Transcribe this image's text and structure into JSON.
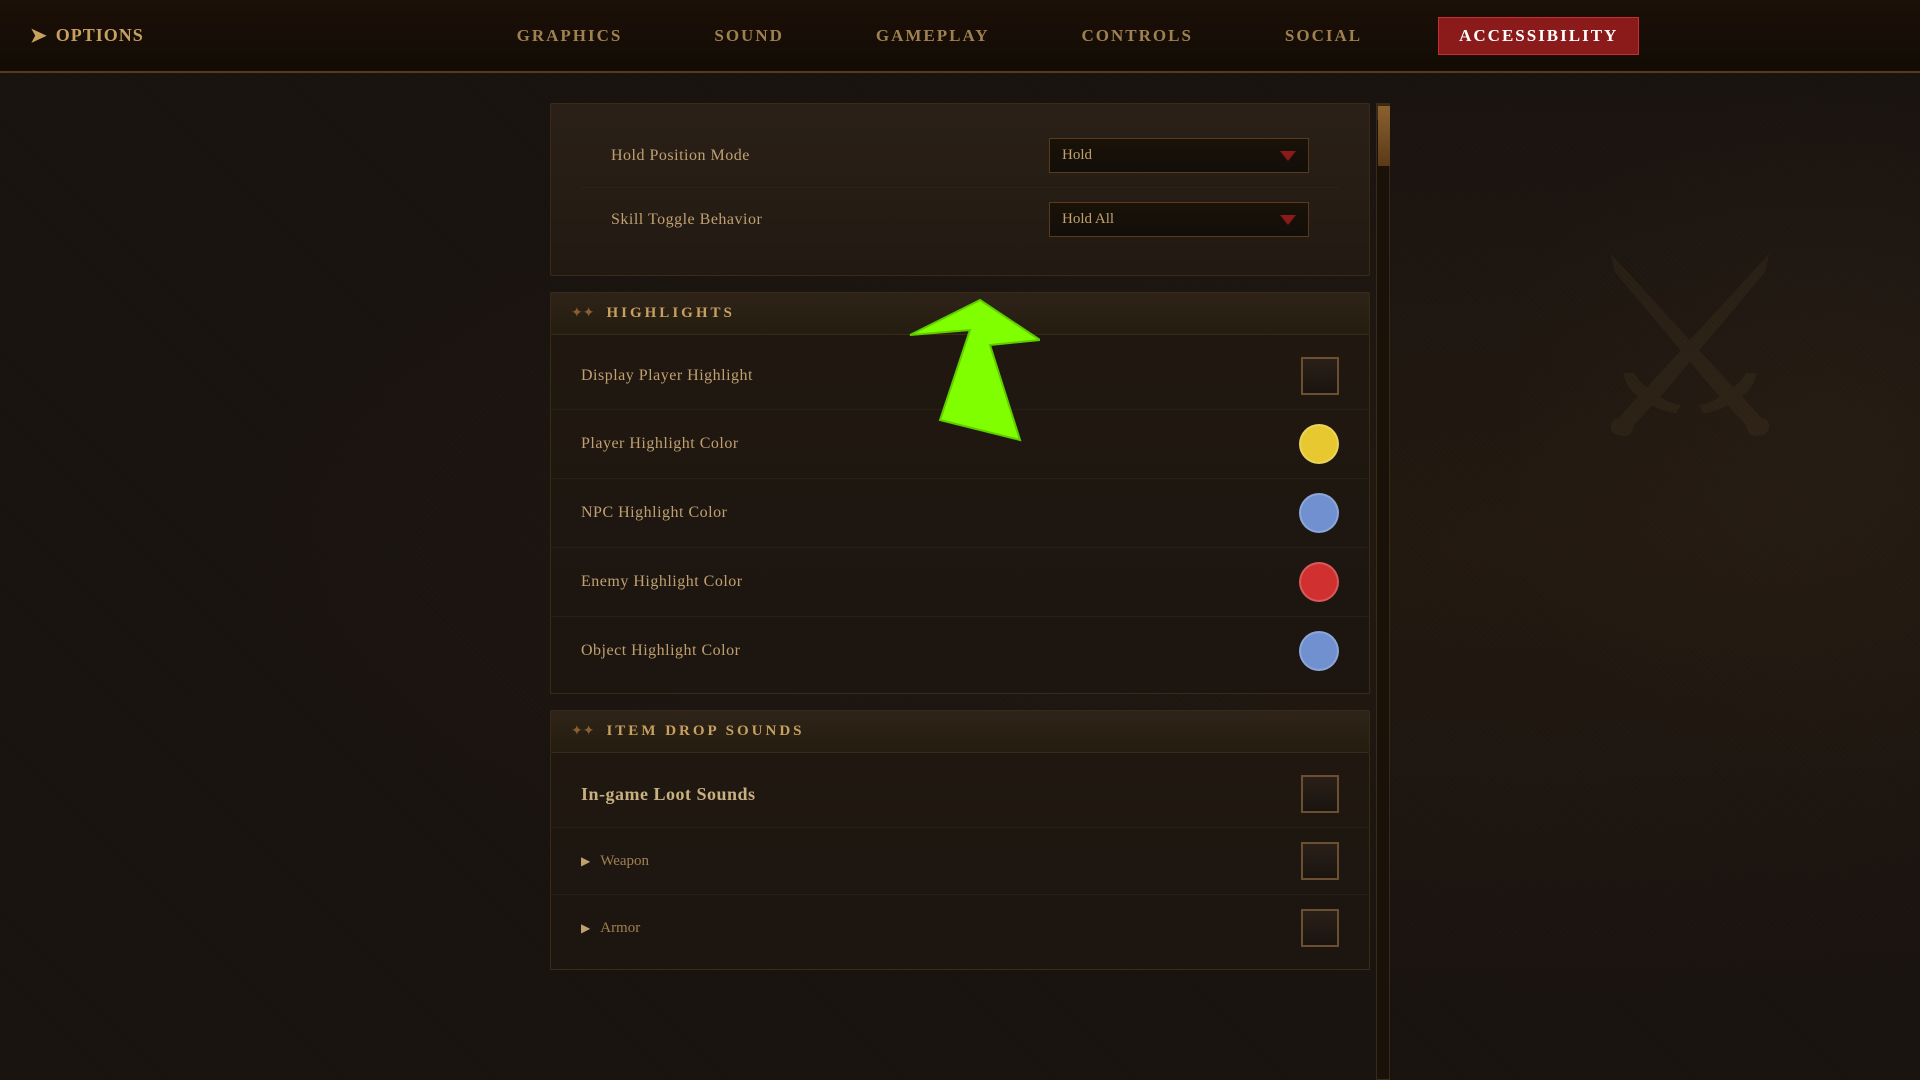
{
  "nav": {
    "options_label": "OPTIONS",
    "tabs": [
      {
        "id": "graphics",
        "label": "GRAPHICS"
      },
      {
        "id": "sound",
        "label": "SOUND"
      },
      {
        "id": "gameplay",
        "label": "GAMEPLAY"
      },
      {
        "id": "controls",
        "label": "CONTROLS"
      },
      {
        "id": "social",
        "label": "SOCIAL"
      },
      {
        "id": "accessibility",
        "label": "ACCESSIBILITY"
      }
    ]
  },
  "top_section": {
    "rows": [
      {
        "label": "Hold Position Mode",
        "control_type": "dropdown",
        "value": "Hold"
      },
      {
        "label": "Skill Toggle Behavior",
        "control_type": "dropdown",
        "value": "Hold All"
      }
    ]
  },
  "highlights_section": {
    "title": "HIGHLIGHTS",
    "rows": [
      {
        "label": "Display Player Highlight",
        "control_type": "checkbox",
        "checked": false
      },
      {
        "label": "Player Highlight Color",
        "control_type": "color",
        "color": "#e8c830"
      },
      {
        "label": "NPC Highlight Color",
        "control_type": "color",
        "color": "#7090d0"
      },
      {
        "label": "Enemy Highlight Color",
        "control_type": "color",
        "color": "#d03030"
      },
      {
        "label": "Object Highlight Color",
        "control_type": "color",
        "color": "#7090d0"
      }
    ]
  },
  "item_drop_sounds_section": {
    "title": "ITEM DROP SOUNDS",
    "rows": [
      {
        "label": "In-game Loot Sounds",
        "control_type": "checkbox",
        "checked": false,
        "large": true
      },
      {
        "label": "Weapon",
        "control_type": "checkbox",
        "checked": false,
        "collapsible": true
      },
      {
        "label": "Armor",
        "control_type": "checkbox",
        "checked": false,
        "collapsible": true
      }
    ]
  },
  "colors": {
    "accent": "#c8a060",
    "danger": "#8b1a1a",
    "bg_dark": "#1a1410"
  }
}
